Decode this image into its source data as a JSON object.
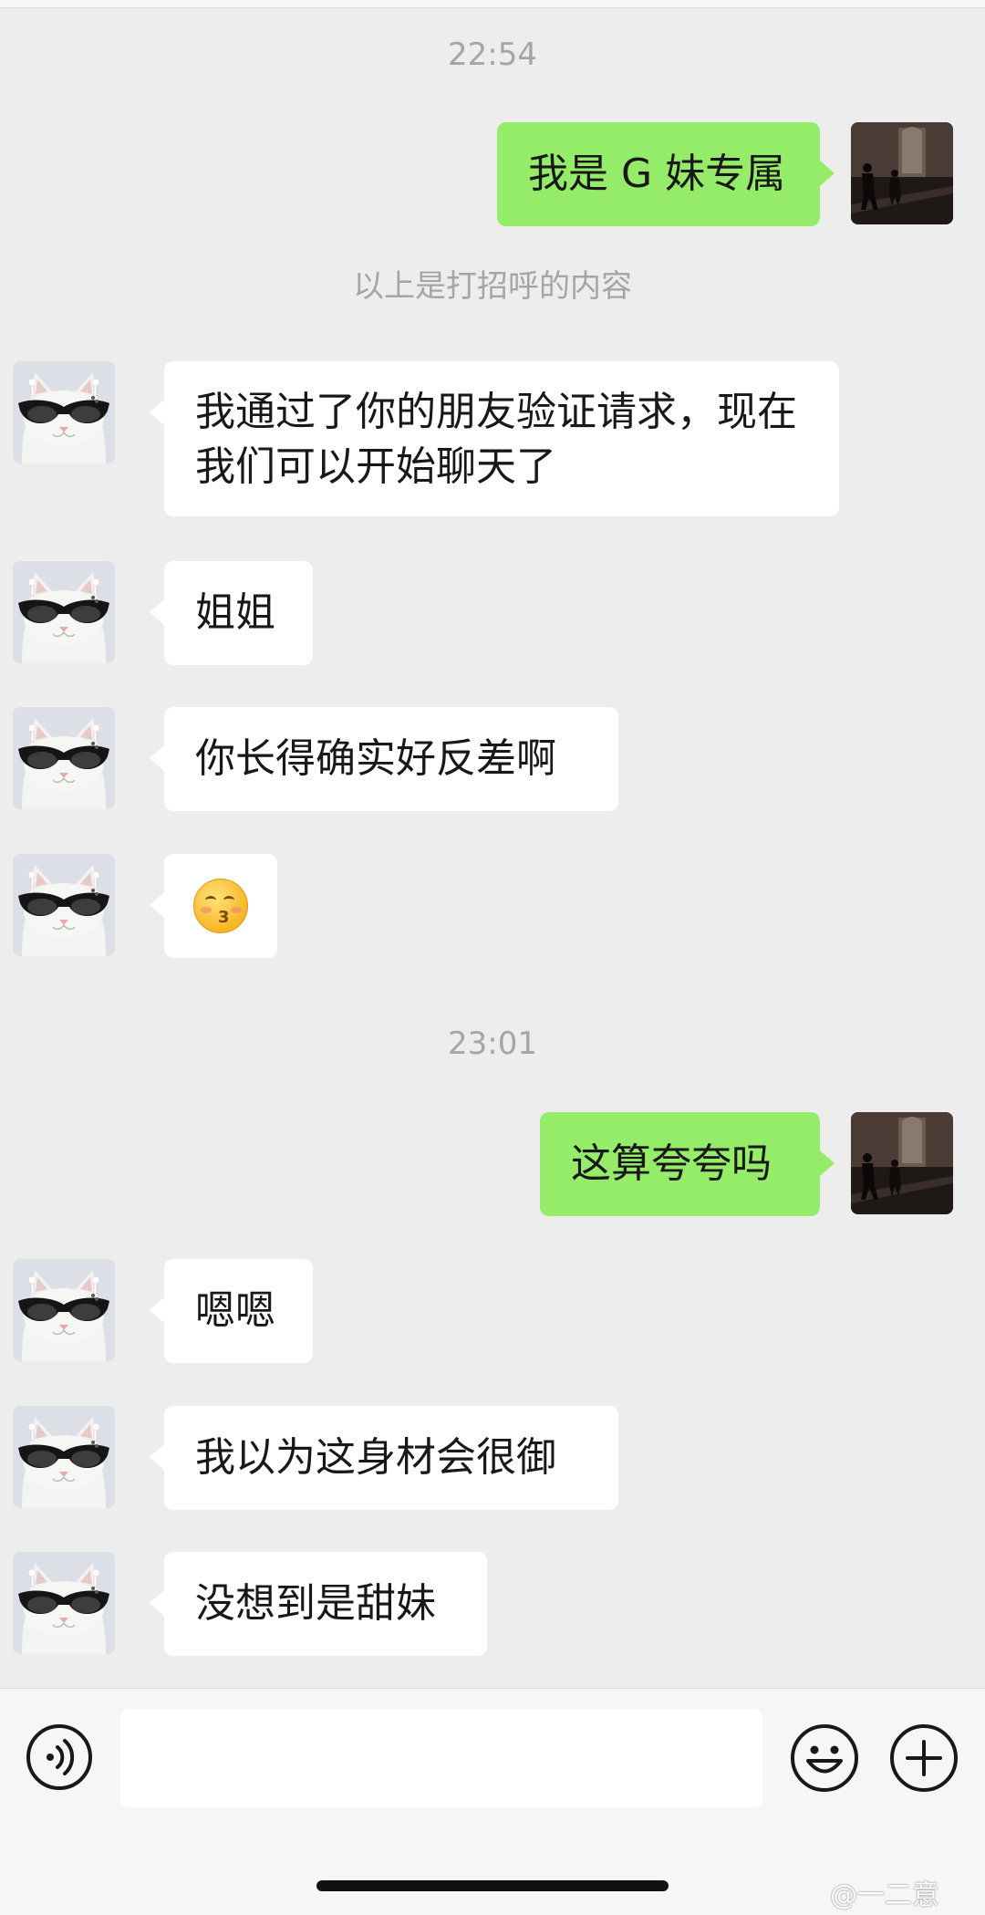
{
  "chat": {
    "time_1": "22:54",
    "system_note": "以上是打招呼的内容",
    "time_2": "23:01",
    "messages": [
      {
        "side": "out",
        "text": "我是 G 妹专属"
      },
      {
        "side": "in",
        "text": "我通过了你的朋友验证请求，现在我们可以开始聊天了"
      },
      {
        "side": "in",
        "text": "姐姐"
      },
      {
        "side": "in",
        "text": "你长得确实好反差啊"
      },
      {
        "side": "in",
        "emoji": "kissing-face-with-smiling-eyes"
      },
      {
        "side": "out",
        "text": "这算夸夸吗"
      },
      {
        "side": "in",
        "text": "嗯嗯"
      },
      {
        "side": "in",
        "text": "我以为这身材会很御"
      },
      {
        "side": "in",
        "text": "没想到是甜妹"
      }
    ]
  },
  "input_bar": {
    "input_value": "",
    "voice_icon": "voice-icon",
    "emoji_icon": "smiley-icon",
    "plus_icon": "plus-icon"
  },
  "watermark": "@一二意",
  "colors": {
    "background": "#ededed",
    "outgoing_bubble": "#95ec69",
    "incoming_bubble": "#ffffff",
    "meta_text": "#a5a5a5"
  }
}
